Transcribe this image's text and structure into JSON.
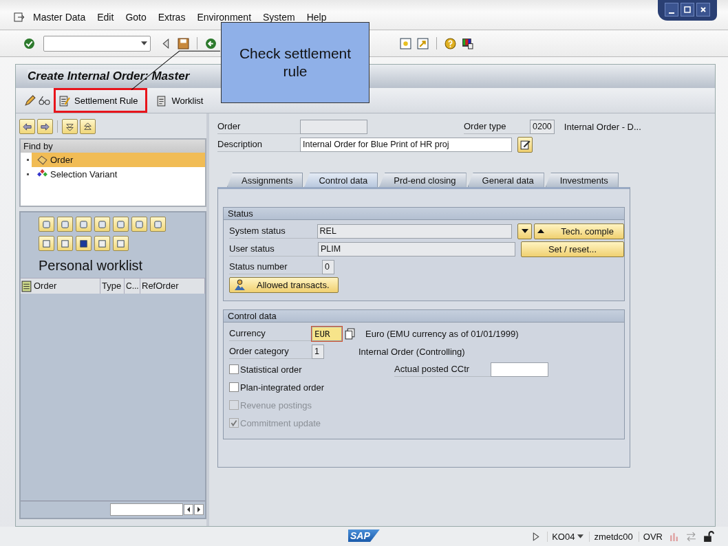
{
  "menu": [
    "Master Data",
    "Edit",
    "Goto",
    "Extras",
    "Environment",
    "System",
    "Help"
  ],
  "title": "Create Internal Order: Master",
  "app_toolbar": [
    {
      "label": "Settlement Rule",
      "highlighted": true
    },
    {
      "label": "Worklist",
      "highlighted": false
    }
  ],
  "callout": {
    "text": "Check settlement rule"
  },
  "find_by": {
    "header": "Find by",
    "items": [
      {
        "label": "Order",
        "selected": true
      },
      {
        "label": "Selection Variant",
        "selected": false
      }
    ]
  },
  "worklist": {
    "title": "Personal worklist",
    "columns": [
      "Order",
      "Type",
      "C...",
      "RefOrder"
    ]
  },
  "header": {
    "order_label": "Order",
    "order_type_label": "Order type",
    "order_type": "0200",
    "order_type_text": "Internal Order - D...",
    "description_label": "Description",
    "description": "Internal Order for Blue Print of HR proj"
  },
  "tabs": [
    {
      "label": "Assignments",
      "selected": false
    },
    {
      "label": "Control data",
      "selected": true
    },
    {
      "label": "Prd-end closing",
      "selected": false
    },
    {
      "label": "General data",
      "selected": false
    },
    {
      "label": "Investments",
      "selected": false
    }
  ],
  "status": {
    "title": "Status",
    "fields": [
      {
        "label": "System status",
        "value": "REL"
      },
      {
        "label": "User status",
        "value": "PLIM"
      }
    ],
    "number_label": "Status number",
    "number": "0",
    "tech_button": "Tech. comple",
    "set_button": "Set / reset...",
    "allowed_button": "Allowed transacts."
  },
  "control": {
    "title": "Control data",
    "currency_label": "Currency",
    "currency": "EUR",
    "currency_text": "Euro (EMU currency as of 01/01/1999)",
    "category_label": "Order category",
    "category": "1",
    "category_text": "Internal Order (Controlling)",
    "cctr_label": "Actual posted CCtr",
    "checkboxes": [
      {
        "label": "Statistical order",
        "checked": false,
        "disabled": false
      },
      {
        "label": "Plan-integrated order",
        "checked": false,
        "disabled": false
      },
      {
        "label": "Revenue postings",
        "checked": false,
        "disabled": true
      },
      {
        "label": "Commitment update",
        "checked": true,
        "disabled": true
      }
    ]
  },
  "status_bar": {
    "logo": "SAP",
    "transaction": "KO04",
    "server": "zmetdc00",
    "mode": "OVR"
  }
}
